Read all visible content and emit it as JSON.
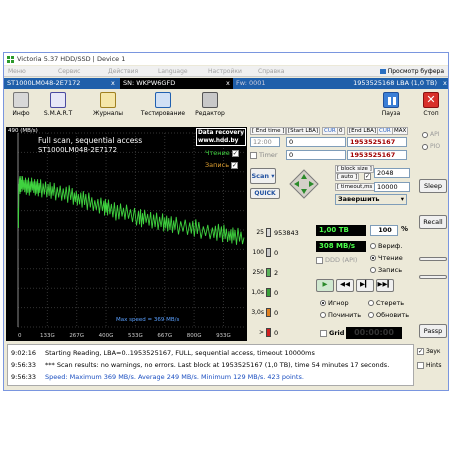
{
  "window": {
    "title": "Victoria 5.37 HDD/SSD | Device 1"
  },
  "menu": {
    "items": [
      "Меню",
      "Сервис",
      "Действия",
      "Language",
      "Настройки",
      "Справка"
    ],
    "buffer_view": "Просмотр буфера"
  },
  "drive": {
    "model": "ST1000LM048-2E7172",
    "close1": "x",
    "serial": "SN: WKPW6GFD",
    "close2": "x",
    "firmware": "Fw: 0001",
    "capacity": "1953525168 LBA (1,0 TB)",
    "close3": "x"
  },
  "toolbar": {
    "info": "Инфо",
    "smart": "S.M.A.R.T",
    "journals": "Журналы",
    "testing": "Тестирование",
    "editor": "Редактор",
    "pause": "Пауза",
    "stop": "Стоп"
  },
  "graph": {
    "ymax_label": "490 (MB/s)",
    "title_line1": "Full scan, sequential access",
    "title_line2": "ST1000LM048-2E7172",
    "datarecovery_line1": "Data recovery",
    "datarecovery_line2": "www.hdd.by",
    "read_label": "Чтение",
    "write_label": "Запись",
    "max_speed": "Max speed = 369 MB/s",
    "x_labels": [
      "0",
      "133G",
      "267G",
      "400G",
      "533G",
      "667G",
      "800G",
      "933G"
    ],
    "y_labels": [
      "490",
      "",
      "",
      "",
      "",
      "",
      "",
      "",
      "",
      "",
      ""
    ]
  },
  "chart_data": {
    "type": "line",
    "title": "Full scan, sequential access",
    "ylabel": "MB/s",
    "ylim": [
      0,
      490
    ],
    "xlim": [
      0,
      1000
    ],
    "x_unit": "GB",
    "series": [
      {
        "name": "Чтение",
        "color": "#3fd23f",
        "x": [
          0,
          2,
          4,
          10,
          20,
          40,
          60,
          80,
          100,
          133,
          160,
          200,
          240,
          267,
          300,
          340,
          380,
          400,
          440,
          480,
          533,
          560,
          600,
          640,
          667,
          700,
          760,
          800,
          860,
          900,
          933,
          960,
          1000
        ],
        "y": [
          300,
          250,
          360,
          360,
          358,
          357,
          355,
          354,
          352,
          348,
          344,
          338,
          332,
          325,
          318,
          310,
          302,
          298,
          292,
          286,
          278,
          274,
          270,
          266,
          262,
          258,
          252,
          246,
          240,
          236,
          232,
          228,
          226
        ]
      }
    ]
  },
  "lba": {
    "end_time_label": "[ End time ]",
    "start_lba_label": "[Start LBA]",
    "cur_label": "CUR",
    "zero_label": "0",
    "end_lba_label": "[End LBA]",
    "cur2_label": "CUR",
    "max_label": "MAX",
    "time_value": "12:00",
    "start_value": "0",
    "end_value": "1953525167",
    "timer_label": "Timer",
    "timer_value": "0",
    "end2_value": "1953525167",
    "block_size_label": "[ block size ]",
    "auto_label": "[ auto ]",
    "block_size_value": "2048",
    "timeout_label": "[ timeout,ms ]",
    "timeout_value": "10000",
    "scan_button": "Scan",
    "quick_button": "QUICK",
    "finish_select": "Завершить"
  },
  "api": {
    "api_label": "API",
    "pio_label": "PIO"
  },
  "side_buttons": {
    "sleep": "Sleep",
    "recall": "Recall",
    "passp": "Passp"
  },
  "stats": {
    "capacity_display": "1,00 TB",
    "percent": "100",
    "percent_sign": "%",
    "speed": "308 MB/s",
    "verify": "Вериф.",
    "read": "Чтение",
    "write": "Запись",
    "ddd": "DDD (API)",
    "rows": [
      {
        "label": "25",
        "count": "953843",
        "color": "#d8d8d8"
      },
      {
        "label": "100",
        "count": "0",
        "color": "#c8c8c8"
      },
      {
        "label": "250",
        "count": "2",
        "color": "#5ab25a"
      },
      {
        "label": "1,0s",
        "count": "0",
        "color": "#3aa03a"
      },
      {
        "label": "3,0s",
        "count": "0",
        "color": "#e08020"
      },
      {
        "label": ">",
        "count": "0",
        "color": "#d02020"
      },
      {
        "label": "Err",
        "count": "0",
        "color": "#2050c0"
      }
    ],
    "ignore": "Игнор",
    "erase": "Стереть",
    "repair": "Починить",
    "refresh": "Обновить",
    "grid": "Grid",
    "timer_display": "00:00:00"
  },
  "log": {
    "rows": [
      {
        "time": "9:02:16",
        "text": "Starting Reading, LBA=0..1953525167, FULL, sequential access, timeout 10000ms"
      },
      {
        "time": "9:56:33",
        "text": "*** Scan results: no warnings, no errors. Last block at 1953525167 (1,0 TB), time 54 minutes 17 seconds."
      },
      {
        "time": "9:56:33",
        "text": "Speed: Maximum 369 MB/s. Average 249 MB/s. Minimum 129 MB/s. 423 points."
      }
    ],
    "sound_label": "Звук",
    "hints_label": "Hints"
  }
}
